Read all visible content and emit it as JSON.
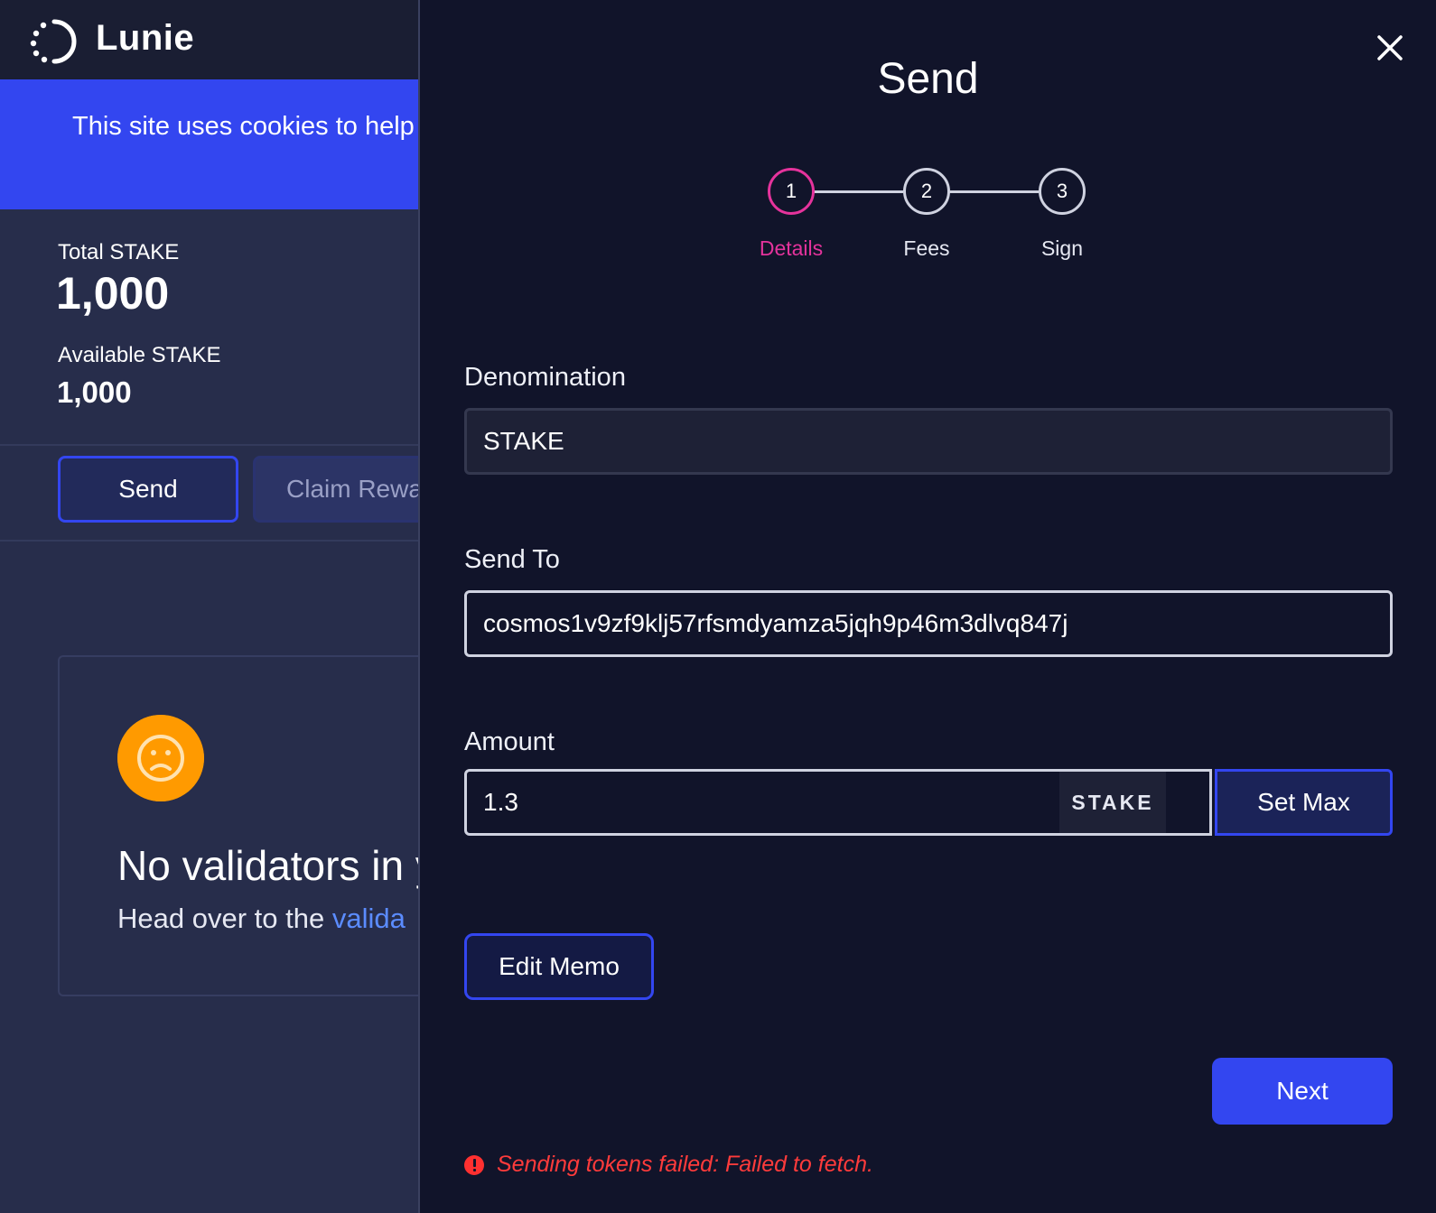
{
  "app": {
    "name": "Lunie",
    "cookie_banner": "This site uses cookies to help",
    "total_label": "Total STAKE",
    "total_value": "1,000",
    "available_label": "Available STAKE",
    "available_value": "1,000",
    "send_button": "Send",
    "claim_button": "Claim Rewa",
    "empty_title": "No validators in y",
    "empty_sub_prefix": "Head over to the ",
    "empty_sub_link": "valida"
  },
  "modal": {
    "title": "Send",
    "steps": [
      {
        "number": "1",
        "label": "Details",
        "active": true
      },
      {
        "number": "2",
        "label": "Fees",
        "active": false
      },
      {
        "number": "3",
        "label": "Sign",
        "active": false
      }
    ],
    "denomination": {
      "label": "Denomination",
      "value": "STAKE"
    },
    "send_to": {
      "label": "Send To",
      "value": "cosmos1v9zf9klj57rfsmdyamza5jqh9p46m3dlvq847j"
    },
    "amount": {
      "label": "Amount",
      "value": "1.3",
      "denom": "STAKE",
      "set_max": "Set Max"
    },
    "edit_memo": "Edit Memo",
    "next": "Next",
    "error": "Sending tokens failed: Failed to fetch."
  },
  "colors": {
    "accent": "#3346f0",
    "step_active": "#e5339c",
    "error": "#ff3b3b",
    "sad_face": "#ff9a00"
  },
  "icons": [
    "lunie-logo-icon",
    "close-icon",
    "sad-face-icon",
    "error-icon"
  ]
}
